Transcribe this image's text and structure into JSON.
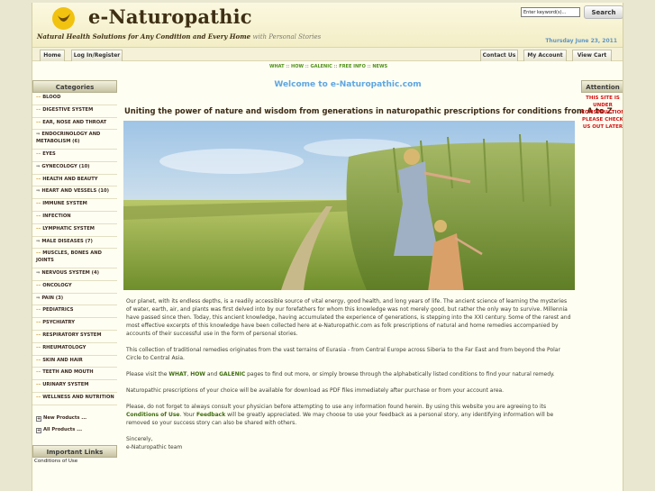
{
  "header": {
    "logo_text": "e-Naturopathic",
    "tagline_bold": "Natural Health Solutions for Any Condition and Every Home",
    "tagline_soft": "with Personal Stories",
    "search_value": "Enter keyword(s)...",
    "search_button": "Search",
    "date": "Thursday June 23, 2011"
  },
  "nav": {
    "home": "Home",
    "login": "Log In/Register",
    "contact": "Contact Us",
    "account": "My Account",
    "cart": "View Cart"
  },
  "subnav": [
    "WHAT",
    "HOW",
    "GALENIC",
    "FREE INFO",
    "NEWS"
  ],
  "subnav_sep": "::",
  "sidebar": {
    "categories_title": "Categories",
    "categories": [
      {
        "label": "BLOOD",
        "mark": "dash"
      },
      {
        "label": "DIGESTIVE SYSTEM",
        "mark": "dash"
      },
      {
        "label": "EAR, NOSE AND THROAT",
        "mark": "dash"
      },
      {
        "label": "ENDOCRINOLOGY AND METABOLISM (6)",
        "mark": "arrow"
      },
      {
        "label": "EYES",
        "mark": "dash"
      },
      {
        "label": "GYNECOLOGY (10)",
        "mark": "arrow"
      },
      {
        "label": "HEALTH AND BEAUTY",
        "mark": "dash"
      },
      {
        "label": "HEART AND VESSELS (10)",
        "mark": "arrow"
      },
      {
        "label": "IMMUNE SYSTEM",
        "mark": "dash"
      },
      {
        "label": "INFECTION",
        "mark": "dash"
      },
      {
        "label": "LYMPHATIC SYSTEM",
        "mark": "dash"
      },
      {
        "label": "MALE DISEASES (7)",
        "mark": "arrow"
      },
      {
        "label": "MUSCLES, BONES AND JOINTS",
        "mark": "dash"
      },
      {
        "label": "NERVOUS SYSTEM (4)",
        "mark": "arrow"
      },
      {
        "label": "ONCOLOGY",
        "mark": "dash"
      },
      {
        "label": "PAIN (3)",
        "mark": "arrow"
      },
      {
        "label": "PEDIATRICS",
        "mark": "dash"
      },
      {
        "label": "PSYCHIATRY",
        "mark": "dash"
      },
      {
        "label": "RESPIRATORY SYSTEM",
        "mark": "dash"
      },
      {
        "label": "RHEUMATOLOGY",
        "mark": "dash"
      },
      {
        "label": "SKIN AND HAIR",
        "mark": "dash"
      },
      {
        "label": "TEETH AND MOUTH",
        "mark": "dash"
      },
      {
        "label": "URINARY SYSTEM",
        "mark": "dash"
      },
      {
        "label": "WELLNESS AND NUTRITION",
        "mark": "dash"
      }
    ],
    "new_products": "New Products ...",
    "all_products": "All Products ...",
    "important_title": "Important Links",
    "important_links": [
      "Conditions of Use"
    ]
  },
  "main": {
    "welcome": "Welcome to e-Naturopathic.com",
    "headline": "Uniting the power of nature and wisdom from generations in naturopathic prescriptions for conditions from A to Z",
    "para1": "Our planet, with its endless depths, is a readily accessible source of vital energy, good health, and long years of life. The ancient science of learning the mysteries of water, earth, air, and plants was first delved into by our forefathers for whom this knowledge was not merely good, but rather the only way to survive. Millennia have passed since then. Today, this ancient knowledge, having accumulated the experience of generations, is stepping into the XXI century. Some of the rarest and most effective excerpts of this knowledge have been collected here at e-Naturopathic.com as folk prescriptions of natural and home remedies accompanied by accounts of their successful use in the form of personal stories.",
    "para2": "This collection of traditional remedies originates from the vast terrains of Eurasia - from Central Europe across Siberia to the Far East and from beyond the Polar Circle to Central Asia.",
    "para3_a": "Please visit the",
    "para3_what": "WHAT",
    "para3_comma": ",",
    "para3_how": "HOW",
    "para3_and": "and",
    "para3_galenic": "GALENIC",
    "para3_b": "pages to find out more, or simply browse through the alphabetically listed conditions to find your natural remedy.",
    "para4": "Naturopathic prescriptions of your choice will be available for download as PDF files immediately after purchase or from your account area.",
    "para5_a": "Please, do not forget to always consult your physician before attempting to use any information found herein. By using this website you are agreeing to its",
    "para5_conditions": "Conditions of Use",
    "para5_b": ". Your",
    "para5_feedback": "Feedback",
    "para5_c": "will be greatly appreciated. We may choose to use your feedback as a personal story, any identifying information will be removed so your success story can also be shared with others.",
    "sign1": "Sincerely,",
    "sign2": "e-Naturopathic team"
  },
  "attention": {
    "title": "Attention",
    "text": "THIS SITE IS UNDER CONSTRUCTION PLEASE CHECK US OUT LATER"
  },
  "colors": {
    "accent_blue": "#5da6e3",
    "attention_red": "#d21212",
    "link_green": "#3e6c10",
    "logo_yellow": "#f1c20f"
  }
}
